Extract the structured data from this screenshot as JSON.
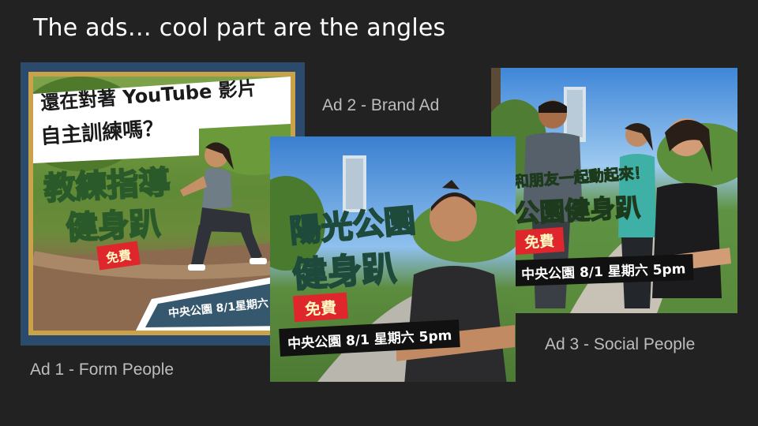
{
  "slide": {
    "title": "The ads… cool part are the angles"
  },
  "ads": [
    {
      "caption": "Ad 1 - Form People",
      "headline_line1": "還在對著 YouTube 影片",
      "headline_line2": "自主訓練嗎？",
      "title_line1": "教練指導",
      "title_line2": "健身趴",
      "badge": "免費",
      "event": "中央公園 8/1星期六"
    },
    {
      "caption": "Ad 2 - Brand Ad",
      "title_line1": "陽光公園",
      "title_line2": "健身趴",
      "badge": "免費",
      "event": "中央公園 8/1 星期六 5pm"
    },
    {
      "caption": "Ad 3 - Social People",
      "title_line1": "和朋友一起動起來！",
      "title_line2": "公園健身趴",
      "badge": "免費",
      "event": "中央公園 8/1 星期六 5pm"
    }
  ],
  "colors": {
    "background": "#222222",
    "ad_yellow": "#f5d21a",
    "badge_red": "#e0262d",
    "ad1_frame": "#2c4a6b"
  }
}
